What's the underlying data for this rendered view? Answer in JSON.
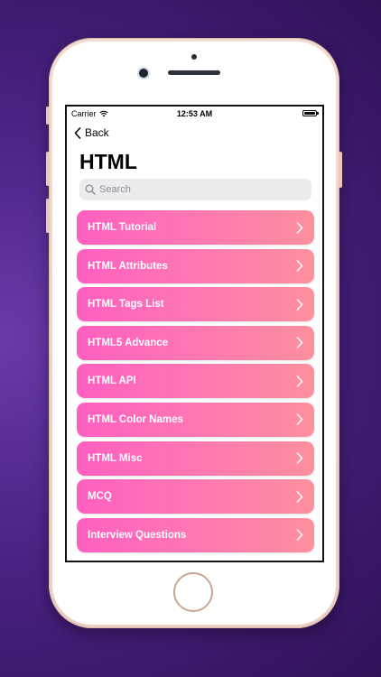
{
  "status_bar": {
    "carrier": "Carrier",
    "time": "12:53 AM"
  },
  "nav": {
    "back_label": "Back"
  },
  "page": {
    "title": "HTML"
  },
  "search": {
    "placeholder": "Search"
  },
  "menu": {
    "items": [
      {
        "label": "HTML Tutorial"
      },
      {
        "label": "HTML Attributes"
      },
      {
        "label": "HTML Tags List"
      },
      {
        "label": "HTML5 Advance"
      },
      {
        "label": "HTML API"
      },
      {
        "label": "HTML Color Names"
      },
      {
        "label": "HTML Misc"
      },
      {
        "label": "MCQ"
      },
      {
        "label": "Interview Questions"
      }
    ]
  },
  "colors": {
    "item_gradient_start": "#ff5fc1",
    "item_gradient_end": "#ff8f9e",
    "background": "#4b2284"
  }
}
